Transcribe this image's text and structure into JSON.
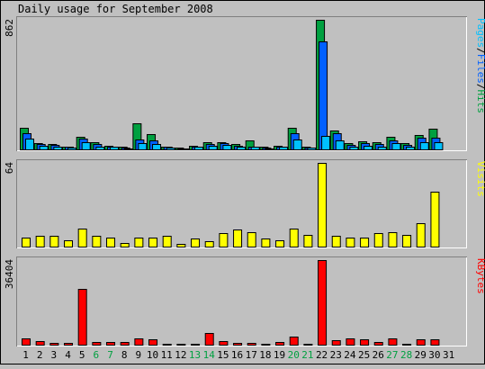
{
  "title": "Daily usage for September 2008",
  "colors": {
    "background": "#c0c0c0",
    "panel": "#c0c0c0",
    "hits": "#00a040",
    "files": "#0060ff",
    "pages": "#00c0ff",
    "visits": "#ffff00",
    "kbytes": "#ff0000",
    "weekend_label": "#00a040",
    "weekday_label": "#000000"
  },
  "chart_data": [
    {
      "type": "bar",
      "panel": "pages-files-hits",
      "categories": [
        "1",
        "2",
        "3",
        "4",
        "5",
        "6",
        "7",
        "8",
        "9",
        "10",
        "11",
        "12",
        "13",
        "14",
        "15",
        "16",
        "17",
        "18",
        "19",
        "20",
        "21",
        "22",
        "23",
        "24",
        "25",
        "26",
        "27",
        "28",
        "29",
        "30",
        "31"
      ],
      "weekend_days": [
        "6",
        "7",
        "13",
        "14",
        "20",
        "21",
        "27",
        "28"
      ],
      "ylabel_parts": [
        {
          "text": "Pages",
          "color_key": "pages"
        },
        {
          "text": "/",
          "color_key": "weekday_label"
        },
        {
          "text": "Files",
          "color_key": "files"
        },
        {
          "text": "/",
          "color_key": "weekday_label"
        },
        {
          "text": "Hits",
          "color_key": "hits"
        }
      ],
      "max_label": "862",
      "ylim": [
        0,
        862
      ],
      "series": [
        {
          "name": "Hits",
          "color_key": "hits",
          "values": [
            145,
            40,
            35,
            20,
            85,
            45,
            25,
            15,
            175,
            100,
            20,
            10,
            25,
            45,
            50,
            35,
            60,
            15,
            25,
            145,
            20,
            862,
            125,
            40,
            55,
            45,
            85,
            40,
            95,
            140,
            0
          ]
        },
        {
          "name": "Files",
          "color_key": "files",
          "values": [
            110,
            35,
            30,
            15,
            70,
            35,
            20,
            10,
            65,
            60,
            15,
            8,
            20,
            35,
            40,
            25,
            20,
            10,
            20,
            110,
            12,
            720,
            105,
            30,
            40,
            35,
            60,
            30,
            75,
            80,
            0
          ]
        },
        {
          "name": "Pages",
          "color_key": "pages",
          "values": [
            70,
            25,
            20,
            10,
            45,
            20,
            15,
            8,
            40,
            35,
            10,
            5,
            15,
            25,
            30,
            18,
            15,
            7,
            15,
            65,
            10,
            90,
            60,
            20,
            25,
            20,
            40,
            20,
            45,
            45,
            0
          ]
        }
      ]
    },
    {
      "type": "bar",
      "panel": "visits",
      "categories": [
        "1",
        "2",
        "3",
        "4",
        "5",
        "6",
        "7",
        "8",
        "9",
        "10",
        "11",
        "12",
        "13",
        "14",
        "15",
        "16",
        "17",
        "18",
        "19",
        "20",
        "21",
        "22",
        "23",
        "24",
        "25",
        "26",
        "27",
        "28",
        "29",
        "30",
        "31"
      ],
      "ylabel_parts": [
        {
          "text": "Visits",
          "color_key": "visits"
        }
      ],
      "max_label": "64",
      "ylim": [
        0,
        64
      ],
      "series": [
        {
          "name": "Visits",
          "color_key": "visits",
          "values": [
            7,
            8,
            8,
            5,
            14,
            8,
            7,
            3,
            7,
            7,
            8,
            2,
            6,
            4,
            10,
            13,
            11,
            6,
            5,
            14,
            9,
            64,
            8,
            7,
            7,
            10,
            11,
            9,
            18,
            42,
            0
          ]
        }
      ]
    },
    {
      "type": "bar",
      "panel": "kbytes",
      "categories": [
        "1",
        "2",
        "3",
        "4",
        "5",
        "6",
        "7",
        "8",
        "9",
        "10",
        "11",
        "12",
        "13",
        "14",
        "15",
        "16",
        "17",
        "18",
        "19",
        "20",
        "21",
        "22",
        "23",
        "24",
        "25",
        "26",
        "27",
        "28",
        "29",
        "30",
        "31"
      ],
      "ylabel_parts": [
        {
          "text": "KBytes",
          "color_key": "kbytes"
        }
      ],
      "max_label": "36404",
      "ylim": [
        0,
        36404
      ],
      "series": [
        {
          "name": "KBytes",
          "color_key": "kbytes",
          "values": [
            2800,
            1500,
            600,
            600,
            24000,
            1000,
            1000,
            1300,
            2800,
            2500,
            300,
            300,
            300,
            5100,
            1500,
            800,
            800,
            400,
            1200,
            3300,
            500,
            36404,
            1800,
            2600,
            2500,
            1100,
            2700,
            400,
            2500,
            2400,
            0
          ]
        }
      ]
    }
  ]
}
